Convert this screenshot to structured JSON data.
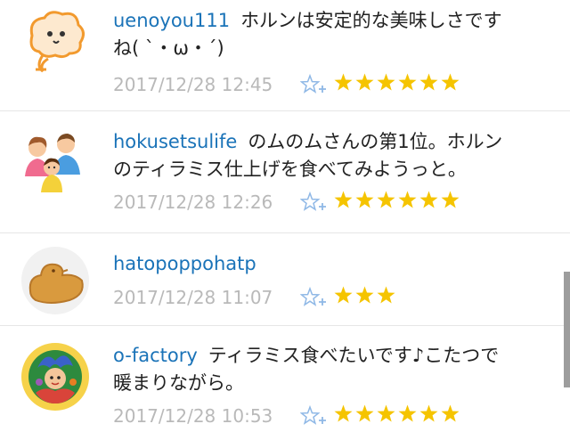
{
  "comments": [
    {
      "username": "uenoyou111",
      "text_line1": "ホルンは安定的な美味しさです",
      "text_line2": "ね( `・ω・´)",
      "timestamp": "2017/12/28 12:45",
      "stars": 6,
      "avatar": "bird-mascot-icon"
    },
    {
      "username": "hokusetsulife",
      "text_line1": "のムのムさんの第1位。ホルン",
      "text_line2": "のティラミス仕上げを食べてみようっと。",
      "timestamp": "2017/12/28 12:26",
      "stars": 6,
      "avatar": "family-icon"
    },
    {
      "username": "hatopoppohatp",
      "text_line1": "",
      "text_line2": "",
      "timestamp": "2017/12/28 11:07",
      "stars": 3,
      "avatar": "pigeon-cookie-icon"
    },
    {
      "username": "o-factory",
      "text_line1": "ティラミス食べたいです♪こたつで",
      "text_line2": "暖まりながら。",
      "timestamp": "2017/12/28 10:53",
      "stars": 6,
      "avatar": "colorful-character-icon"
    }
  ],
  "colors": {
    "username": "#1a73b8",
    "star_gold": "#f5c400",
    "add_star_blue": "#8fb8e6",
    "timestamp": "#b9b9b9"
  }
}
